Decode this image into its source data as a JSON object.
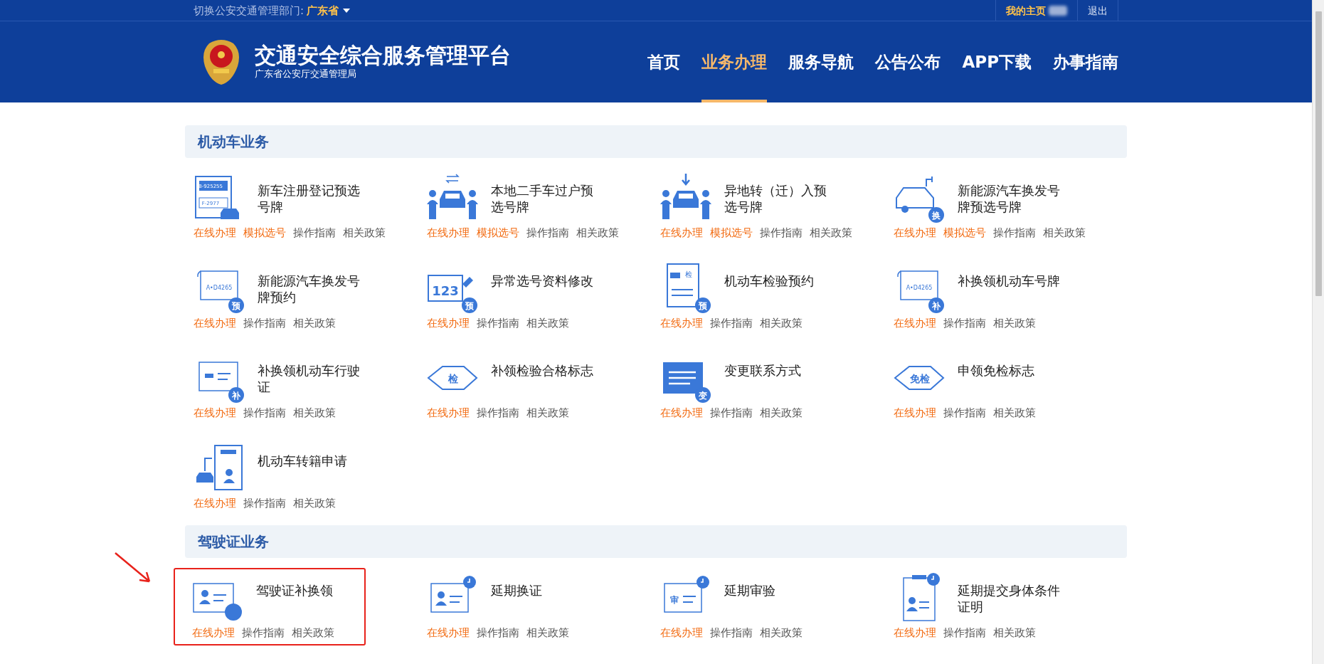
{
  "topbar": {
    "switch_label": "切换公安交通管理部门:",
    "region": "广东省",
    "my_home": "我的主页",
    "logout": "退出"
  },
  "header": {
    "title": "交通安全综合服务管理平台",
    "subtitle": "广东省公安厅交通管理局",
    "nav": [
      {
        "label": "首页",
        "selected": false
      },
      {
        "label": "业务办理",
        "selected": true
      },
      {
        "label": "服务导航",
        "selected": false
      },
      {
        "label": "公告公布",
        "selected": false
      },
      {
        "label": "APP下载",
        "selected": false
      },
      {
        "label": "办事指南",
        "selected": false
      }
    ]
  },
  "sections": [
    {
      "title": "机动车业务",
      "items": [
        {
          "title": "新车注册登记预选号牌",
          "kind": "plates",
          "icon_texts": [
            "B-925255",
            "F-2977"
          ],
          "highlighted": false,
          "links": [
            {
              "label": "在线办理",
              "kind": "primary"
            },
            {
              "label": "模拟选号",
              "kind": "primary"
            },
            {
              "label": "操作指南",
              "kind": "normal"
            },
            {
              "label": "相关政策",
              "kind": "normal"
            }
          ]
        },
        {
          "title": "本地二手车过户预选号牌",
          "kind": "car-swap",
          "highlighted": false,
          "links": [
            {
              "label": "在线办理",
              "kind": "primary"
            },
            {
              "label": "模拟选号",
              "kind": "primary"
            },
            {
              "label": "操作指南",
              "kind": "normal"
            },
            {
              "label": "相关政策",
              "kind": "normal"
            }
          ]
        },
        {
          "title": "异地转（迁）入预选号牌",
          "kind": "car-arrive",
          "highlighted": false,
          "links": [
            {
              "label": "在线办理",
              "kind": "primary"
            },
            {
              "label": "模拟选号",
              "kind": "primary"
            },
            {
              "label": "操作指南",
              "kind": "normal"
            },
            {
              "label": "相关政策",
              "kind": "normal"
            }
          ]
        },
        {
          "title": "新能源汽车换发号牌预选号牌",
          "kind": "ev-car",
          "badge": "换",
          "highlighted": false,
          "links": [
            {
              "label": "在线办理",
              "kind": "primary"
            },
            {
              "label": "模拟选号",
              "kind": "primary"
            },
            {
              "label": "操作指南",
              "kind": "normal"
            },
            {
              "label": "相关政策",
              "kind": "normal"
            }
          ]
        },
        {
          "title": "新能源汽车换发号牌预约",
          "kind": "plate",
          "icon_texts": [
            "A•D4265"
          ],
          "badge": "预",
          "highlighted": false,
          "links": [
            {
              "label": "在线办理",
              "kind": "primary"
            },
            {
              "label": "操作指南",
              "kind": "normal"
            },
            {
              "label": "相关政策",
              "kind": "normal"
            }
          ]
        },
        {
          "title": "异常选号资料修改",
          "kind": "number",
          "icon_texts": [
            "123"
          ],
          "badge": "预",
          "highlighted": false,
          "links": [
            {
              "label": "在线办理",
              "kind": "primary"
            },
            {
              "label": "操作指南",
              "kind": "normal"
            },
            {
              "label": "相关政策",
              "kind": "normal"
            }
          ]
        },
        {
          "title": "机动车检验预约",
          "kind": "doc",
          "icon_texts": [
            "检"
          ],
          "badge": "预",
          "highlighted": false,
          "links": [
            {
              "label": "在线办理",
              "kind": "primary"
            },
            {
              "label": "操作指南",
              "kind": "normal"
            },
            {
              "label": "相关政策",
              "kind": "normal"
            }
          ]
        },
        {
          "title": "补换领机动车号牌",
          "kind": "plate",
          "icon_texts": [
            "A•D4265"
          ],
          "badge": "补",
          "highlighted": false,
          "links": [
            {
              "label": "在线办理",
              "kind": "primary"
            },
            {
              "label": "操作指南",
              "kind": "normal"
            },
            {
              "label": "相关政策",
              "kind": "normal"
            }
          ]
        },
        {
          "title": "补换领机动车行驶证",
          "kind": "license",
          "badge": "补",
          "highlighted": false,
          "links": [
            {
              "label": "在线办理",
              "kind": "primary"
            },
            {
              "label": "操作指南",
              "kind": "normal"
            },
            {
              "label": "相关政策",
              "kind": "normal"
            }
          ]
        },
        {
          "title": "补领检验合格标志",
          "kind": "diamond",
          "icon_texts": [
            "检"
          ],
          "highlighted": false,
          "links": [
            {
              "label": "在线办理",
              "kind": "primary"
            },
            {
              "label": "操作指南",
              "kind": "normal"
            },
            {
              "label": "相关政策",
              "kind": "normal"
            }
          ]
        },
        {
          "title": "变更联系方式",
          "kind": "form",
          "badge": "变",
          "highlighted": false,
          "links": [
            {
              "label": "在线办理",
              "kind": "primary"
            },
            {
              "label": "操作指南",
              "kind": "normal"
            },
            {
              "label": "相关政策",
              "kind": "normal"
            }
          ]
        },
        {
          "title": "申领免检标志",
          "kind": "diamond",
          "icon_texts": [
            "免检"
          ],
          "highlighted": false,
          "links": [
            {
              "label": "在线办理",
              "kind": "primary"
            },
            {
              "label": "操作指南",
              "kind": "normal"
            },
            {
              "label": "相关政策",
              "kind": "normal"
            }
          ]
        },
        {
          "title": "机动车转籍申请",
          "kind": "transfer",
          "highlighted": false,
          "links": [
            {
              "label": "在线办理",
              "kind": "primary"
            },
            {
              "label": "操作指南",
              "kind": "normal"
            },
            {
              "label": "相关政策",
              "kind": "normal"
            }
          ]
        }
      ]
    },
    {
      "title": "驾驶证业务",
      "items": [
        {
          "title": "驾驶证补换领",
          "kind": "id-card",
          "highlighted": true,
          "links": [
            {
              "label": "在线办理",
              "kind": "primary"
            },
            {
              "label": "操作指南",
              "kind": "normal"
            },
            {
              "label": "相关政策",
              "kind": "normal"
            }
          ]
        },
        {
          "title": "延期换证",
          "kind": "id-clock",
          "highlighted": false,
          "links": [
            {
              "label": "在线办理",
              "kind": "primary"
            },
            {
              "label": "操作指南",
              "kind": "normal"
            },
            {
              "label": "相关政策",
              "kind": "normal"
            }
          ]
        },
        {
          "title": "延期审验",
          "kind": "card-clock",
          "icon_texts": [
            "审"
          ],
          "highlighted": false,
          "links": [
            {
              "label": "在线办理",
              "kind": "primary"
            },
            {
              "label": "操作指南",
              "kind": "normal"
            },
            {
              "label": "相关政策",
              "kind": "normal"
            }
          ]
        },
        {
          "title": "延期提交身体条件证明",
          "kind": "doc-clock",
          "highlighted": false,
          "links": [
            {
              "label": "在线办理",
              "kind": "primary"
            },
            {
              "label": "操作指南",
              "kind": "normal"
            },
            {
              "label": "相关政策",
              "kind": "normal"
            }
          ]
        }
      ]
    }
  ]
}
